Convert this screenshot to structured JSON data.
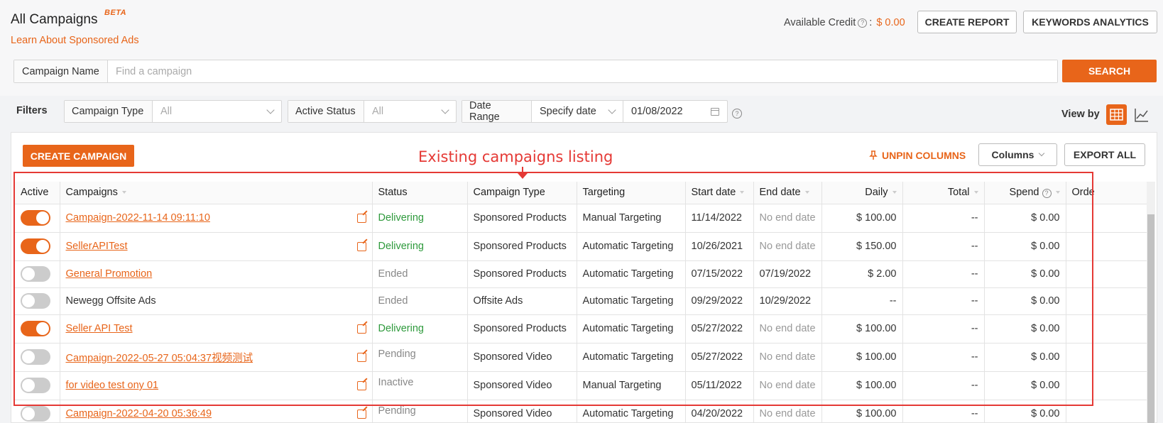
{
  "header": {
    "title": "All Campaigns",
    "beta": "BETA",
    "learn_link": "Learn About Sponsored Ads",
    "credit_label": "Available Credit",
    "credit_sep": ":",
    "credit_amount": "$ 0.00",
    "create_report": "CREATE REPORT",
    "keywords_analytics": "KEYWORDS ANALYTICS"
  },
  "search": {
    "label": "Campaign Name",
    "placeholder": "Find a campaign",
    "button": "SEARCH"
  },
  "filters": {
    "label": "Filters",
    "campaign_type_label": "Campaign Type",
    "campaign_type_value": "All",
    "active_status_label": "Active Status",
    "active_status_value": "All",
    "date_range_label": "Date Range",
    "date_mode": "Specify date",
    "date_value": "01/08/2022",
    "view_by": "View by"
  },
  "toolbar": {
    "create_campaign": "CREATE CAMPAIGN",
    "annotation": "Existing campaigns listing",
    "unpin": "UNPIN COLUMNS",
    "columns": "Columns",
    "export": "EXPORT ALL"
  },
  "table": {
    "headers": {
      "active": "Active",
      "campaigns": "Campaigns",
      "status": "Status",
      "campaign_type": "Campaign Type",
      "targeting": "Targeting",
      "start": "Start date",
      "end": "End date",
      "daily": "Daily",
      "total": "Total",
      "spend": "Spend",
      "orders": "Orde"
    },
    "rows": [
      {
        "name": "Campaign-2022-11-14 09:11:10",
        "status": "Delivering",
        "type": "Sponsored Products",
        "targeting": "Manual Targeting",
        "start": "11/14/2022",
        "end": "No end date",
        "daily": "$ 100.00",
        "total": "--",
        "spend": "$ 0.00"
      },
      {
        "name": "SellerAPITest",
        "status": "Delivering",
        "type": "Sponsored Products",
        "targeting": "Automatic Targeting",
        "start": "10/26/2021",
        "end": "No end date",
        "daily": "$ 150.00",
        "total": "--",
        "spend": "$ 0.00"
      },
      {
        "name": "General Promotion",
        "status": "Ended",
        "type": "Sponsored Products",
        "targeting": "Automatic Targeting",
        "start": "07/15/2022",
        "end": "07/19/2022",
        "daily": "$ 2.00",
        "total": "--",
        "spend": "$ 0.00"
      },
      {
        "name": "Newegg Offsite Ads",
        "status": "Ended",
        "type": "Offsite Ads",
        "targeting": "Automatic Targeting",
        "start": "09/29/2022",
        "end": "10/29/2022",
        "daily": "--",
        "total": "--",
        "spend": "$ 0.00"
      },
      {
        "name": "Seller API Test",
        "status": "Delivering",
        "type": "Sponsored Products",
        "targeting": "Automatic Targeting",
        "start": "05/27/2022",
        "end": "No end date",
        "daily": "$ 100.00",
        "total": "--",
        "spend": "$ 0.00"
      },
      {
        "name": "Campaign-2022-05-27 05:04:37视频测试",
        "status": "Pending",
        "type": "Sponsored Video",
        "targeting": "Automatic Targeting",
        "start": "05/27/2022",
        "end": "No end date",
        "daily": "$ 100.00",
        "total": "--",
        "spend": "$ 0.00"
      },
      {
        "name": "for video test ony 01",
        "status": "Inactive",
        "type": "Sponsored Video",
        "targeting": "Manual Targeting",
        "start": "05/11/2022",
        "end": "No end date",
        "daily": "$ 100.00",
        "total": "--",
        "spend": "$ 0.00"
      },
      {
        "name": "Campaign-2022-04-20 05:36:49",
        "status": "Pending",
        "type": "Sponsored Video",
        "targeting": "Automatic Targeting",
        "start": "04/20/2022",
        "end": "No end date",
        "daily": "$ 100.00",
        "total": "--",
        "spend": "$ 0.00"
      }
    ]
  }
}
